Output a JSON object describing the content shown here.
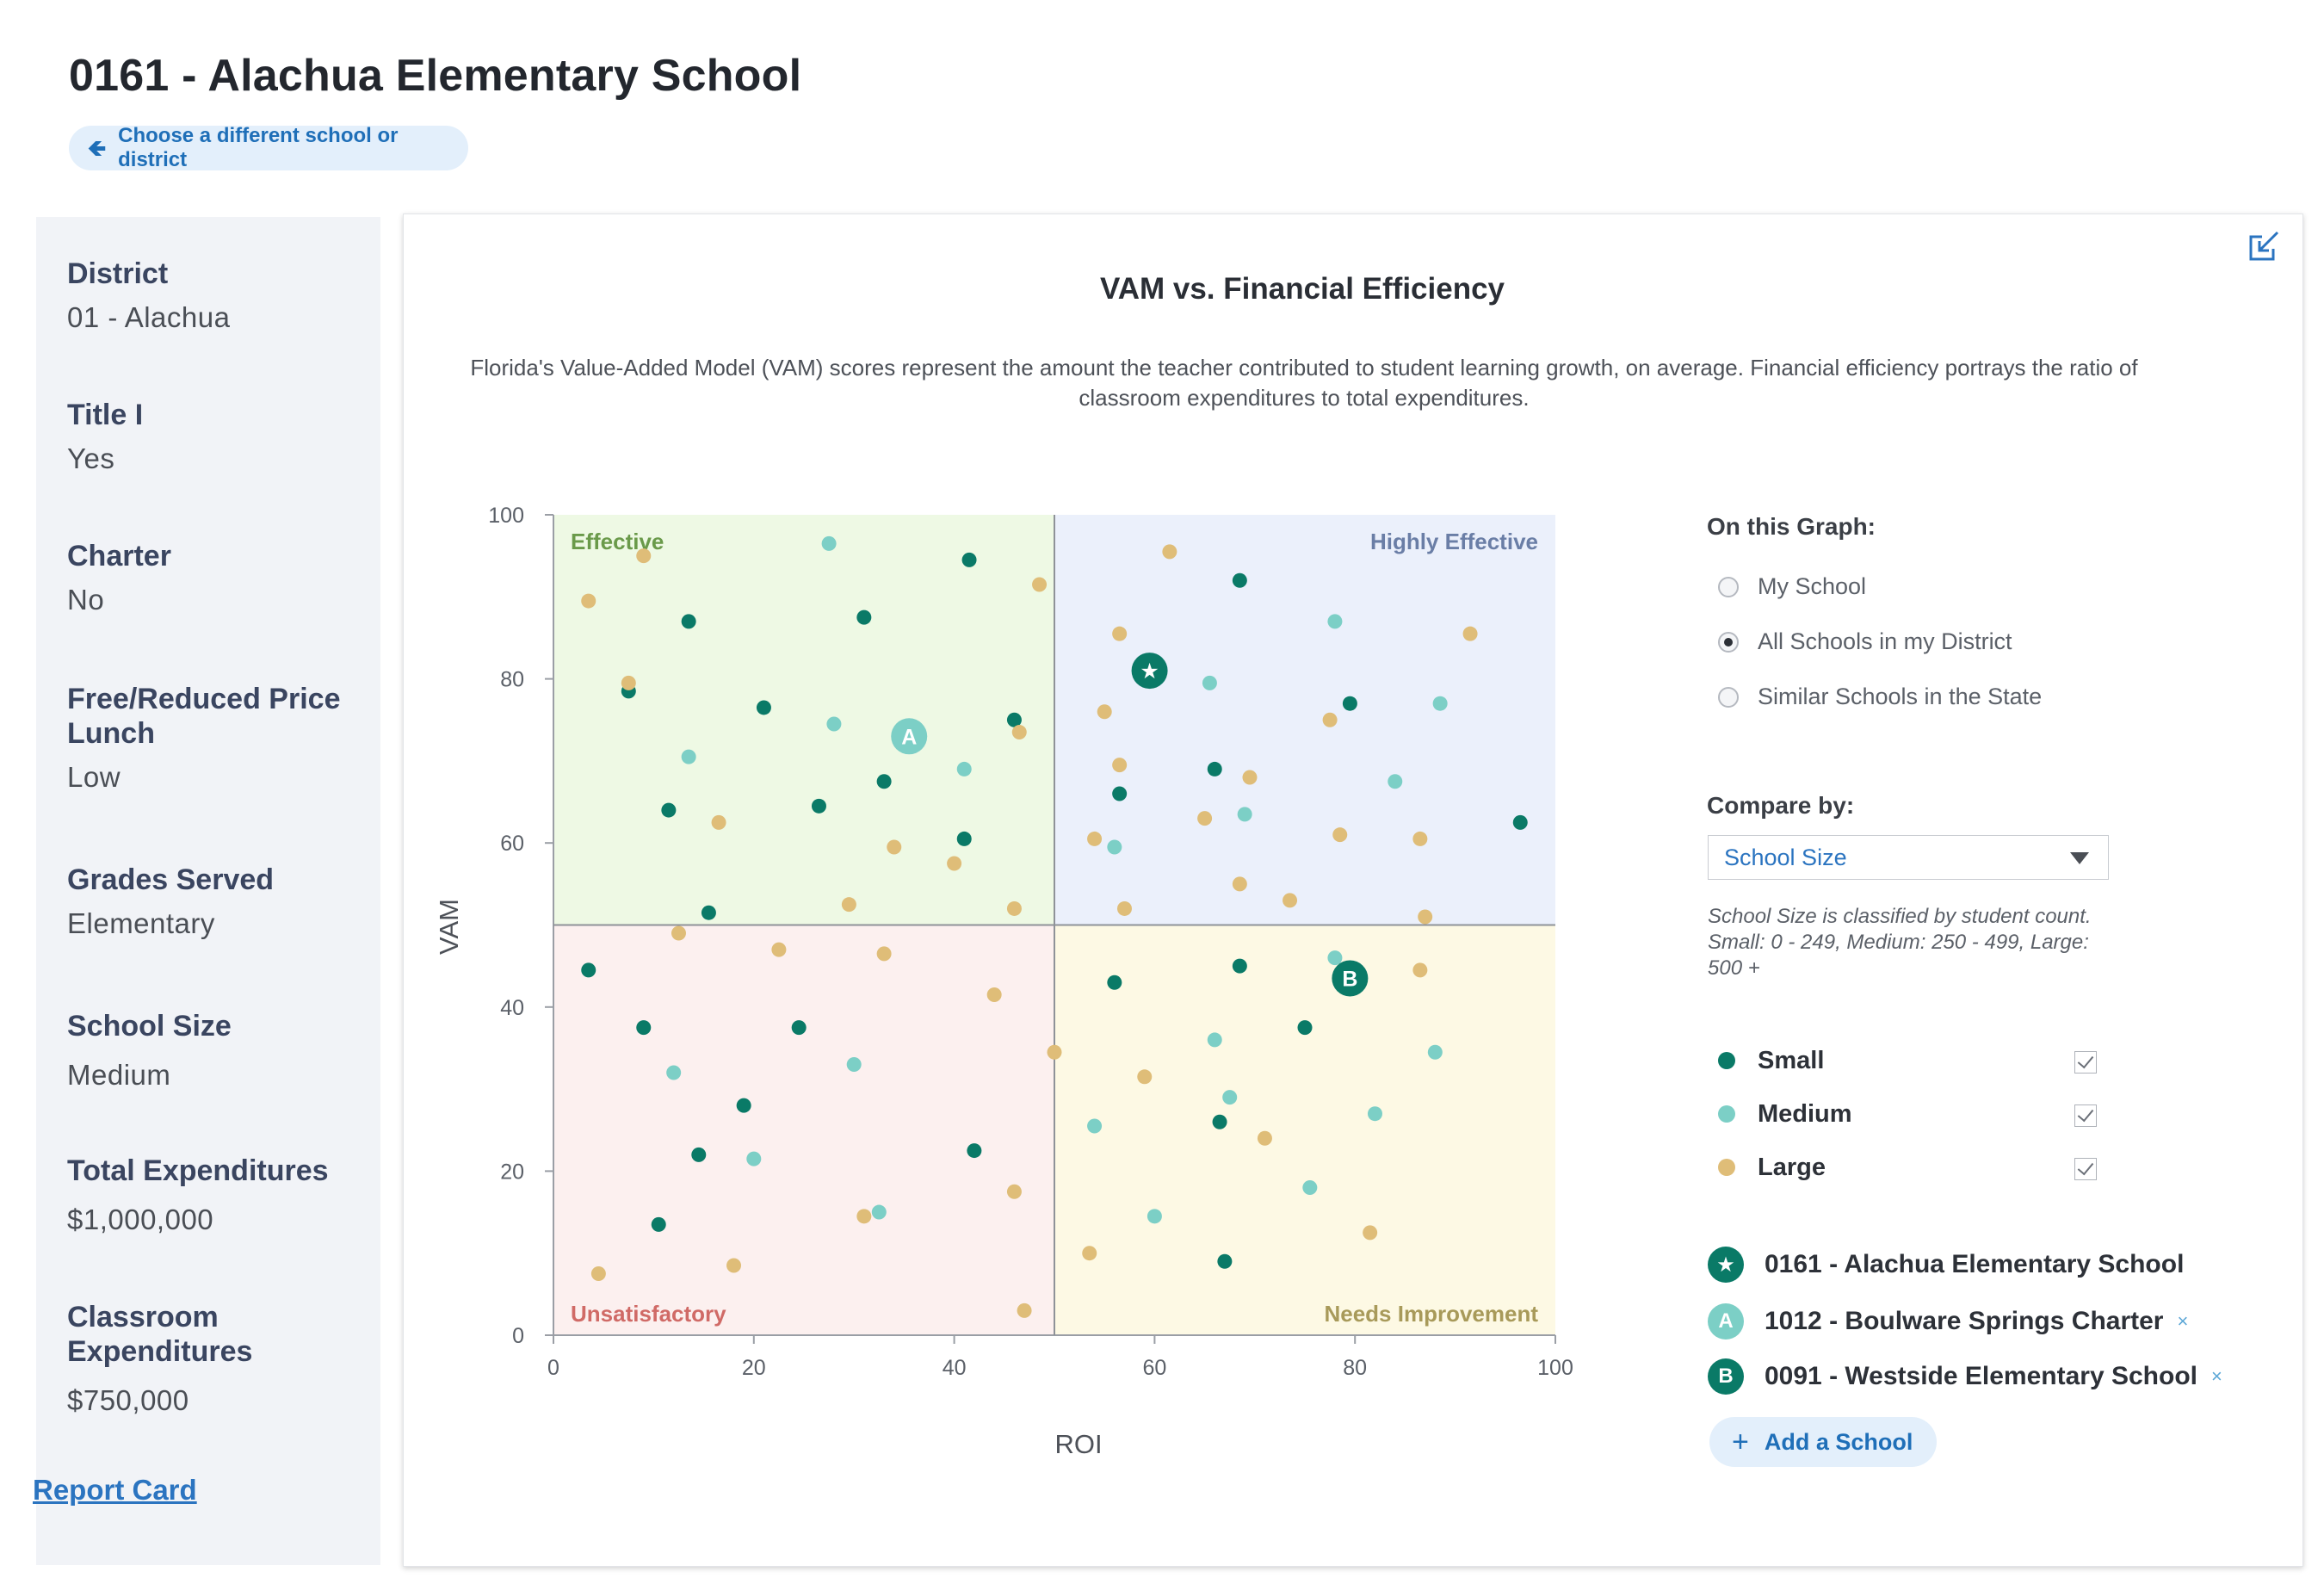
{
  "header": {
    "title": "0161 - Alachua Elementary School",
    "back_label": "Choose a different school or district"
  },
  "sidebar": {
    "items": [
      {
        "label": "District",
        "value": "01 - Alachua"
      },
      {
        "label": "Title I",
        "value": "Yes"
      },
      {
        "label": "Charter",
        "value": "No"
      },
      {
        "label": "Free/Reduced Price Lunch",
        "value": "Low"
      },
      {
        "label": "Grades Served",
        "value": "Elementary"
      },
      {
        "label": "School Size",
        "value": "Medium"
      },
      {
        "label": "Total Expenditures",
        "value": "$1,000,000"
      },
      {
        "label": "Classroom Expenditures",
        "value": "$750,000"
      }
    ],
    "link": "Report Card"
  },
  "card": {
    "title": "VAM vs. Financial Efficiency",
    "description": "Florida's Value-Added Model (VAM) scores represent the amount the teacher contributed to student learning growth, on average. Financial efficiency portrays the ratio of classroom expenditures to total expenditures."
  },
  "panel": {
    "graph_heading": "On this Graph:",
    "graph_options": [
      {
        "label": "My School",
        "selected": false
      },
      {
        "label": "All Schools in my District",
        "selected": true
      },
      {
        "label": "Similar Schools in the State",
        "selected": false
      }
    ],
    "compare_heading": "Compare by:",
    "compare_value": "School Size",
    "note": "School Size is classified by student count. Small: 0 - 249, Medium: 250 - 499, Large: 500 +",
    "legend": [
      {
        "label": "Small",
        "color": "#0a7a67",
        "checked": true
      },
      {
        "label": "Medium",
        "color": "#7ccfc6",
        "checked": true
      },
      {
        "label": "Large",
        "color": "#dfbd78",
        "checked": true
      }
    ],
    "schools": [
      {
        "badge": "★",
        "name": "0161 - Alachua Elementary School",
        "removable": false
      },
      {
        "badge": "A",
        "name": "1012 - Boulware Springs Charter",
        "removable": true
      },
      {
        "badge": "B",
        "name": "0091 - Westside Elementary School",
        "removable": true
      }
    ],
    "remove_glyph": "×",
    "add_label": "Add a School"
  },
  "chart_data": {
    "type": "scatter",
    "title": "VAM vs. Financial Efficiency",
    "xlabel": "ROI",
    "ylabel": "VAM",
    "xlim": [
      0,
      100
    ],
    "ylim": [
      0,
      100
    ],
    "xticks": [
      0,
      20,
      40,
      60,
      80,
      100
    ],
    "yticks": [
      0,
      20,
      40,
      60,
      80,
      100
    ],
    "quadrants": [
      {
        "label": "Effective",
        "color": "#eef9e4",
        "text_color": "#6a9a4a",
        "position": "top-left"
      },
      {
        "label": "Highly Effective",
        "color": "#ebf0fb",
        "text_color": "#6a7ea6",
        "position": "top-right"
      },
      {
        "label": "Unsatisfactory",
        "color": "#fcf0ef",
        "text_color": "#d06a66",
        "position": "bottom-left"
      },
      {
        "label": "Needs Improvement",
        "color": "#fdf9e4",
        "text_color": "#a89a5a",
        "position": "bottom-right"
      }
    ],
    "series": [
      {
        "name": "Small",
        "color": "#0a7a67",
        "points": [
          [
            41.5,
            94.5
          ],
          [
            13.5,
            87
          ],
          [
            31,
            87.5
          ],
          [
            68.5,
            92
          ],
          [
            7.5,
            78.5
          ],
          [
            21,
            76.5
          ],
          [
            46,
            75
          ],
          [
            79.5,
            77
          ],
          [
            33,
            67.5
          ],
          [
            66,
            69
          ],
          [
            56.5,
            66
          ],
          [
            11.5,
            64
          ],
          [
            26.5,
            64.5
          ],
          [
            41,
            60.5
          ],
          [
            96.5,
            62.5
          ],
          [
            15.5,
            51.5
          ],
          [
            3.5,
            44.5
          ],
          [
            9,
            37.5
          ],
          [
            24.5,
            37.5
          ],
          [
            56,
            43
          ],
          [
            68.5,
            45
          ],
          [
            75,
            37.5
          ],
          [
            19,
            28
          ],
          [
            14.5,
            22
          ],
          [
            42,
            22.5
          ],
          [
            66.5,
            26
          ],
          [
            10.5,
            13.5
          ],
          [
            67,
            9
          ]
        ]
      },
      {
        "name": "Medium",
        "color": "#7ccfc6",
        "points": [
          [
            27.5,
            96.5
          ],
          [
            78,
            87
          ],
          [
            28,
            74.5
          ],
          [
            13.5,
            70.5
          ],
          [
            41,
            69
          ],
          [
            65.5,
            79.5
          ],
          [
            88.5,
            77
          ],
          [
            84,
            67.5
          ],
          [
            69,
            63.5
          ],
          [
            56,
            59.5
          ],
          [
            12,
            32
          ],
          [
            20,
            21.5
          ],
          [
            30,
            33
          ],
          [
            32.5,
            15
          ],
          [
            78,
            46
          ],
          [
            66,
            36
          ],
          [
            88,
            34.5
          ],
          [
            67.5,
            29
          ],
          [
            54,
            25.5
          ],
          [
            82,
            27
          ],
          [
            75.5,
            18
          ],
          [
            60,
            14.5
          ]
        ]
      },
      {
        "name": "Large",
        "color": "#dfbd78",
        "points": [
          [
            9,
            95
          ],
          [
            48.5,
            91.5
          ],
          [
            3.5,
            89.5
          ],
          [
            61.5,
            95.5
          ],
          [
            56.5,
            85.5
          ],
          [
            91.5,
            85.5
          ],
          [
            7.5,
            79.5
          ],
          [
            46.5,
            73.5
          ],
          [
            55,
            76
          ],
          [
            77.5,
            75
          ],
          [
            56.5,
            69.5
          ],
          [
            69.5,
            68
          ],
          [
            16.5,
            62.5
          ],
          [
            34,
            59.5
          ],
          [
            40,
            57.5
          ],
          [
            54,
            60.5
          ],
          [
            65,
            63
          ],
          [
            78.5,
            61
          ],
          [
            86.5,
            60.5
          ],
          [
            68.5,
            55
          ],
          [
            73.5,
            53
          ],
          [
            87,
            51
          ],
          [
            29.5,
            52.5
          ],
          [
            46,
            52
          ],
          [
            57,
            52
          ],
          [
            12.5,
            49
          ],
          [
            22.5,
            47
          ],
          [
            33,
            46.5
          ],
          [
            44,
            41.5
          ],
          [
            86.5,
            44.5
          ],
          [
            50,
            34.5
          ],
          [
            59,
            31.5
          ],
          [
            71,
            24
          ],
          [
            46,
            17.5
          ],
          [
            31,
            14.5
          ],
          [
            81.5,
            12.5
          ],
          [
            53.5,
            10
          ],
          [
            4.5,
            7.5
          ],
          [
            18,
            8.5
          ],
          [
            47,
            3
          ]
        ]
      }
    ],
    "highlights": [
      {
        "label": "★",
        "x": 59.5,
        "y": 81,
        "color": "#0a7a67"
      },
      {
        "label": "A",
        "x": 35.5,
        "y": 73,
        "color": "#7ccfc6"
      },
      {
        "label": "B",
        "x": 79.5,
        "y": 43.5,
        "color": "#0a7a67"
      }
    ]
  }
}
